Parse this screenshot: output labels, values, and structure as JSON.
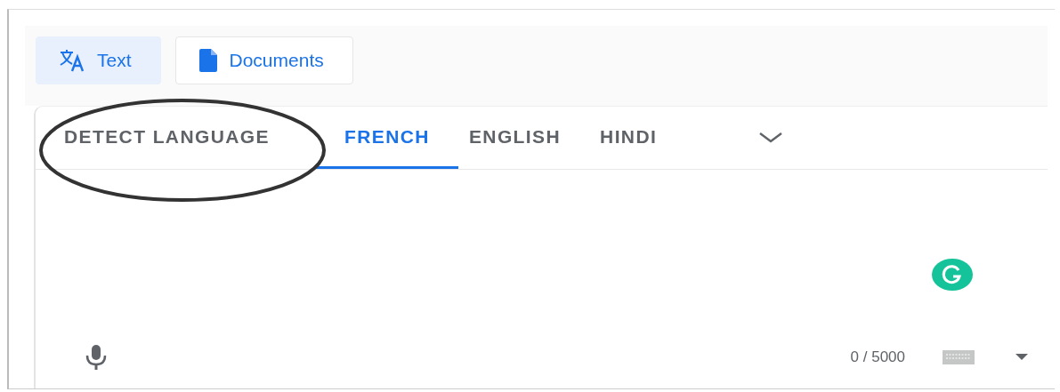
{
  "modes": [
    {
      "label": "Text",
      "kind": "text",
      "selected": true
    },
    {
      "label": "Documents",
      "kind": "document",
      "selected": false
    }
  ],
  "languages": [
    {
      "label": "DETECT LANGUAGE",
      "selected": false,
      "circled": true
    },
    {
      "label": "FRENCH",
      "selected": true,
      "circled": false
    },
    {
      "label": "ENGLISH",
      "selected": false,
      "circled": false
    },
    {
      "label": "HINDI",
      "selected": false,
      "circled": false
    }
  ],
  "char_count": "0 / 5000"
}
